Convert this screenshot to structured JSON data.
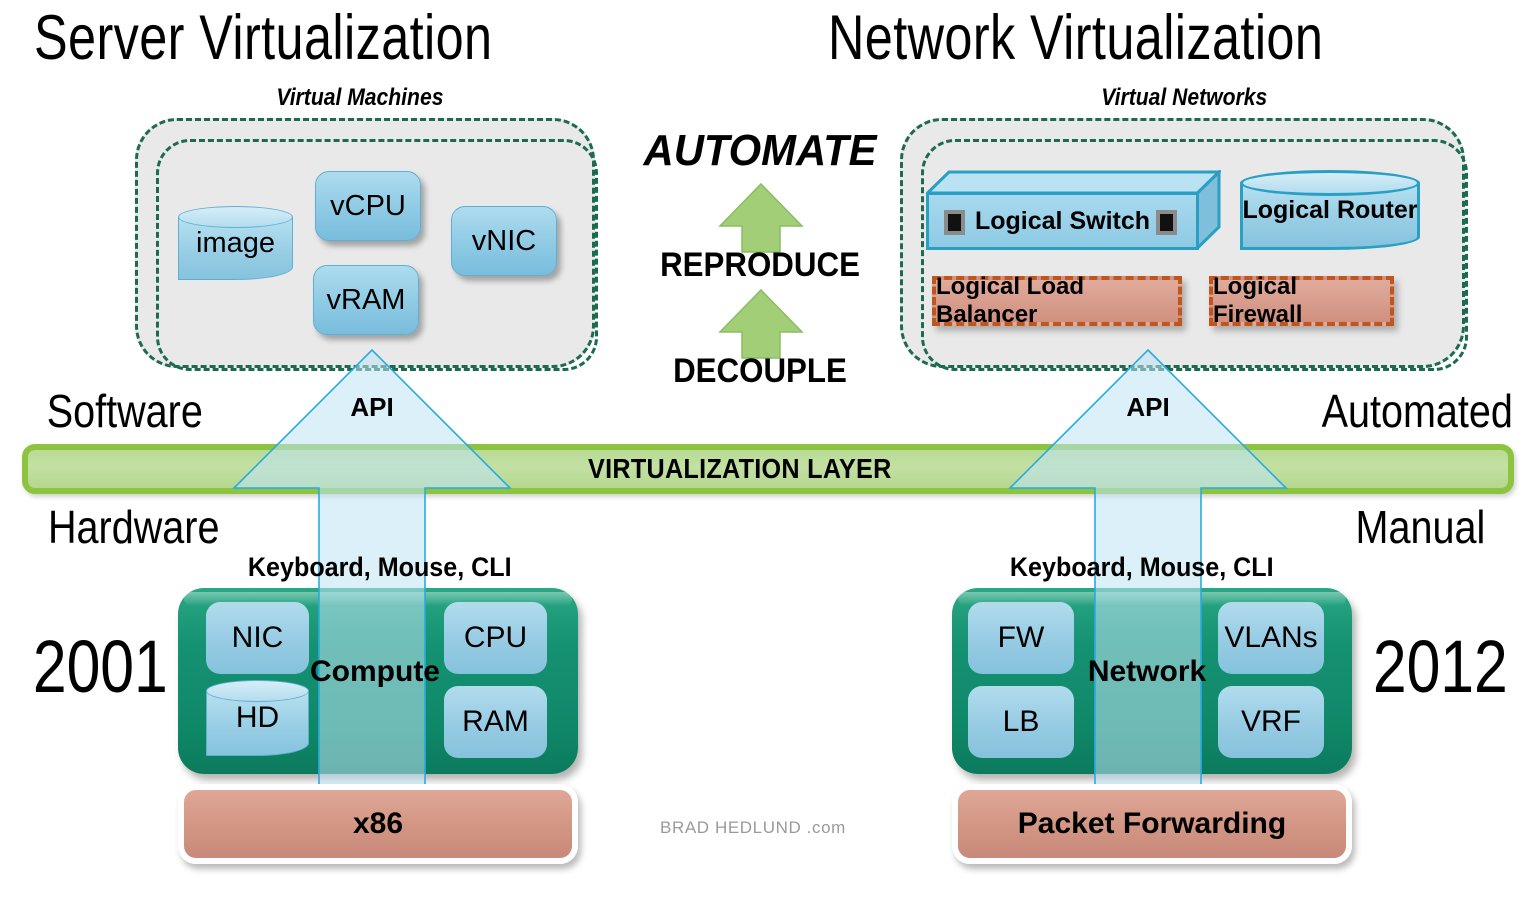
{
  "titles": {
    "left": "Server Virtualization",
    "right": "Network Virtualization"
  },
  "captions": {
    "left": "Virtual Machines",
    "right": "Virtual Networks"
  },
  "virtual_machines": [
    {
      "label": "image",
      "shape": "cylinder"
    },
    {
      "label": "vCPU",
      "shape": "rounded-rect"
    },
    {
      "label": "vRAM",
      "shape": "rounded-rect"
    },
    {
      "label": "vNIC",
      "shape": "rounded-rect"
    }
  ],
  "virtual_networks": [
    {
      "label": "Logical Switch",
      "shape": "switch-3d"
    },
    {
      "label": "Logical Router",
      "shape": "cylinder"
    },
    {
      "label": "Logical Load Balancer",
      "shape": "dashed-rect"
    },
    {
      "label": "Logical Firewall",
      "shape": "dashed-rect"
    }
  ],
  "center_flow": {
    "top": "AUTOMATE",
    "middle": "REPRODUCE",
    "bottom": "DECOUPLE",
    "arrow_color": "#A0CE74"
  },
  "virtualization_layer": {
    "label": "VIRTUALIZATION LAYER",
    "bar_border_color": "#8CC440",
    "bar_fill_color": "#BCDC9A"
  },
  "api_arrows": {
    "left_label": "API",
    "right_label": "API",
    "color": "#29ABE2"
  },
  "side_labels": {
    "left_top": "Software",
    "left_bottom": "Hardware",
    "right_top": "Automated",
    "right_bottom": "Manual"
  },
  "years": {
    "left": "2001",
    "right": "2012"
  },
  "input_labels": {
    "left": "Keyboard, Mouse, CLI",
    "right": "Keyboard, Mouse, CLI"
  },
  "compute_stack": {
    "center_label": "Compute",
    "components": [
      {
        "label": "NIC",
        "shape": "rounded-rect"
      },
      {
        "label": "CPU",
        "shape": "rounded-rect"
      },
      {
        "label": "HD",
        "shape": "cylinder"
      },
      {
        "label": "RAM",
        "shape": "rounded-rect"
      }
    ],
    "foundation": "x86",
    "container_color": "#0F8868"
  },
  "network_stack": {
    "center_label": "Network",
    "components": [
      {
        "label": "FW",
        "shape": "rounded-rect"
      },
      {
        "label": "VLANs",
        "shape": "rounded-rect"
      },
      {
        "label": "LB",
        "shape": "rounded-rect"
      },
      {
        "label": "VRF",
        "shape": "rounded-rect"
      }
    ],
    "foundation": "Packet Forwarding",
    "container_color": "#0F8868"
  },
  "credit": "BRAD HEDLUND .com"
}
